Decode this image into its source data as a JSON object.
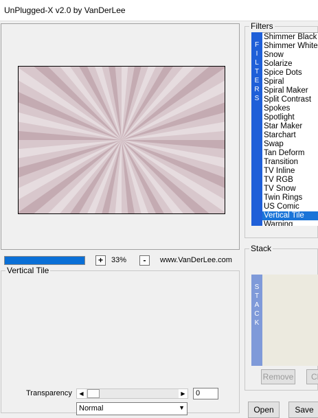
{
  "window": {
    "title": "UnPlugged-X v2.0 by VanDerLee"
  },
  "preview": {
    "progress": 1.0
  },
  "zoom": {
    "plus_label": "+",
    "minus_label": "-",
    "value": "33%",
    "site": "www.VanDerLee.com"
  },
  "settings": {
    "legend": "Vertical Tile",
    "transparency_label": "Transparency",
    "transparency_value": "0",
    "blend_mode": "Normal"
  },
  "filters": {
    "legend": "Filters",
    "vertical_label": "FILTERS",
    "items": [
      "Shimmer Black",
      "Shimmer White",
      "Snow",
      "Solarize",
      "Spice Dots",
      "Spiral",
      "Spiral Maker",
      "Split Contrast",
      "Spokes",
      "Spotlight",
      "Star Maker",
      "Starchart",
      "Swap",
      "Tan Deform",
      "Transition",
      "TV Inline",
      "TV RGB",
      "TV Snow",
      "Twin Rings",
      "US Comic",
      "Vertical Tile",
      "Warping"
    ],
    "selected": "Vertical Tile"
  },
  "stack": {
    "legend": "Stack",
    "vertical_label": "STACK",
    "remove_label": "Remove",
    "clear_label": "Cl"
  },
  "buttons": {
    "open": "Open",
    "save": "Save"
  },
  "colors": {
    "accent": "#1a74d8",
    "filter_band": "#1f5fd8",
    "stack_band": "#7f9ad9",
    "preview_tint": "#d8c7cc"
  }
}
